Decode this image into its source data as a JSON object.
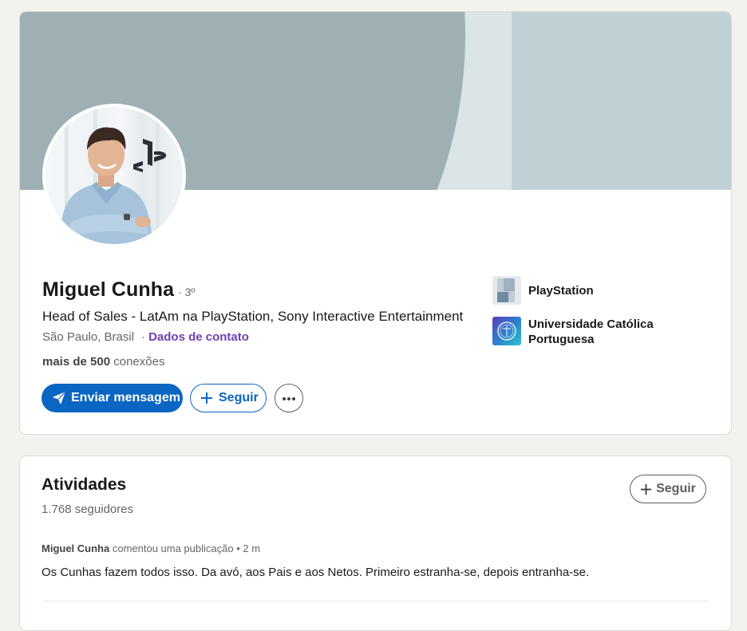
{
  "profile": {
    "name": "Miguel Cunha",
    "degree": "· 3º",
    "headline": "Head of Sales - LatAm na PlayStation, Sony Interactive Entertainment",
    "location": "São Paulo, Brasil",
    "location_separator": "·",
    "contact_link": "Dados de contato",
    "connections_count": "mais de 500",
    "connections_label": "conexões",
    "actions": {
      "message_label": "Enviar mensagem",
      "follow_label": "Seguir",
      "more_icon": "ellipsis-icon"
    },
    "companies": [
      {
        "name": "PlayStation",
        "logo": "playstation-logo"
      },
      {
        "name": "Universidade Católica Portuguesa",
        "logo": "universidade-catolica-logo"
      }
    ],
    "colors": {
      "primary": "#0a66c2",
      "contact_link": "#6e3fb5",
      "banner_dark": "#9eb0b3",
      "banner_light": "#c0d1d6"
    }
  },
  "activity": {
    "title": "Atividades",
    "followers": "1.768 seguidores",
    "follow_label": "Seguir",
    "post": {
      "author": "Miguel Cunha",
      "action": "comentou uma publicação",
      "time": "• 2 m",
      "text": "Os Cunhas fazem todos isso. Da avó, aos Pais  e aos Netos. Primeiro estranha-se, depois entranha-se."
    }
  }
}
